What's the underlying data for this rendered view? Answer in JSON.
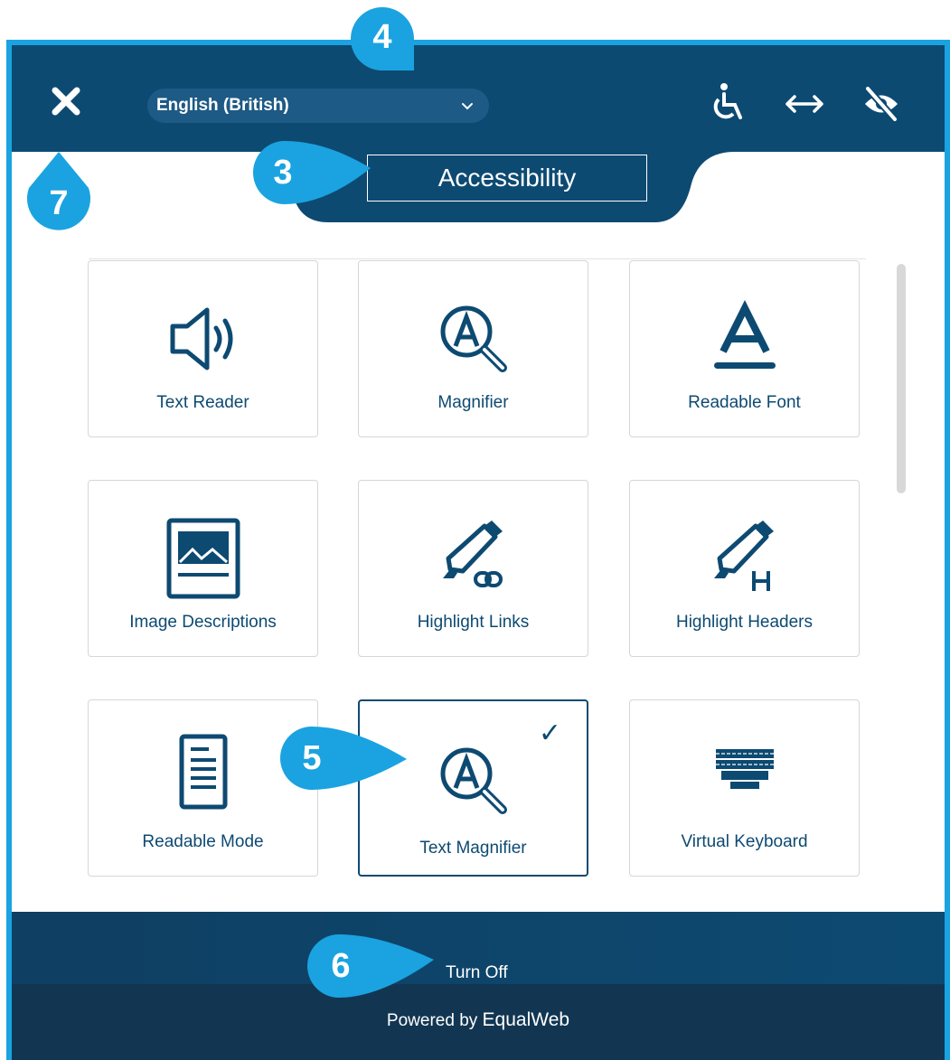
{
  "header": {
    "language_selected": "English (British)"
  },
  "tab": {
    "title": "Accessibility"
  },
  "tiles": [
    {
      "label": "Text Reader",
      "icon": "speaker-icon"
    },
    {
      "label": "Magnifier",
      "icon": "magnifier-icon"
    },
    {
      "label": "Readable Font",
      "icon": "readable-font-icon"
    },
    {
      "label": "Image Descriptions",
      "icon": "image-icon"
    },
    {
      "label": "Highlight Links",
      "icon": "highlight-links-icon"
    },
    {
      "label": "Highlight Headers",
      "icon": "highlight-headers-icon"
    },
    {
      "label": "Readable Mode",
      "icon": "document-icon"
    },
    {
      "label": "Text Magnifier",
      "icon": "text-magnifier-icon",
      "selected": true,
      "check": "✓"
    },
    {
      "label": "Virtual Keyboard",
      "icon": "keyboard-icon"
    }
  ],
  "footer": {
    "turn_off_label": "Turn Off",
    "powered_prefix": "Powered by ",
    "powered_brand": "EqualWeb"
  },
  "callouts": {
    "c3": "3",
    "c4": "4",
    "c5": "5",
    "c6": "6",
    "c7": "7"
  },
  "colors": {
    "brand_dark": "#0d4a72",
    "callout_blue": "#1aa3e0",
    "border_blue": "#1aa3e0"
  }
}
